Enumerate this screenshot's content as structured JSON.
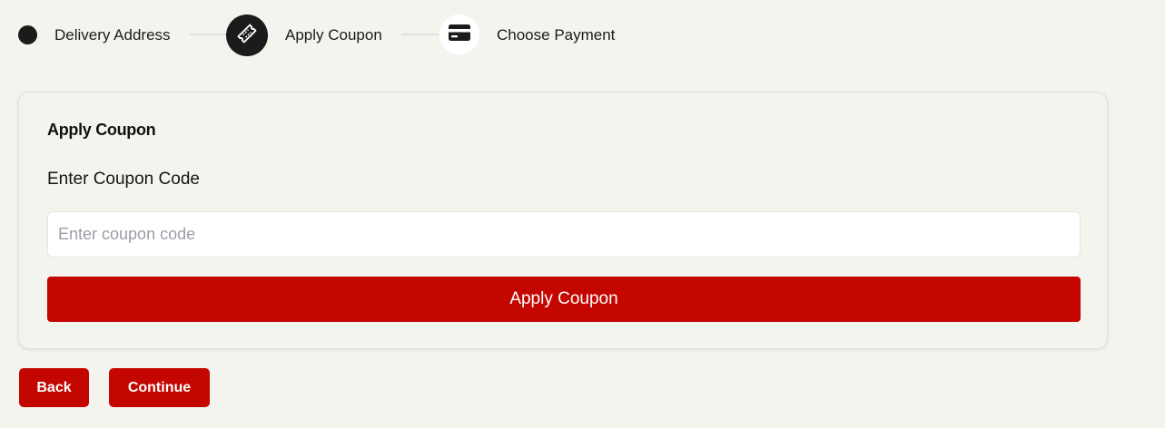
{
  "stepper": {
    "steps": [
      {
        "label": "Delivery Address",
        "icon": "dot-icon",
        "state": "completed"
      },
      {
        "label": "Apply Coupon",
        "icon": "ticket-icon",
        "state": "active"
      },
      {
        "label": "Choose Payment",
        "icon": "credit-card-icon",
        "state": "upcoming"
      }
    ]
  },
  "coupon_card": {
    "title": "Apply Coupon",
    "field_label": "Enter Coupon Code",
    "input_value": "",
    "input_placeholder": "Enter coupon code",
    "apply_button_label": "Apply Coupon"
  },
  "footer": {
    "back_label": "Back",
    "continue_label": "Continue"
  },
  "colors": {
    "accent": "#c40600",
    "background": "#f4f4ef",
    "step_active": "#1b1b1b"
  }
}
